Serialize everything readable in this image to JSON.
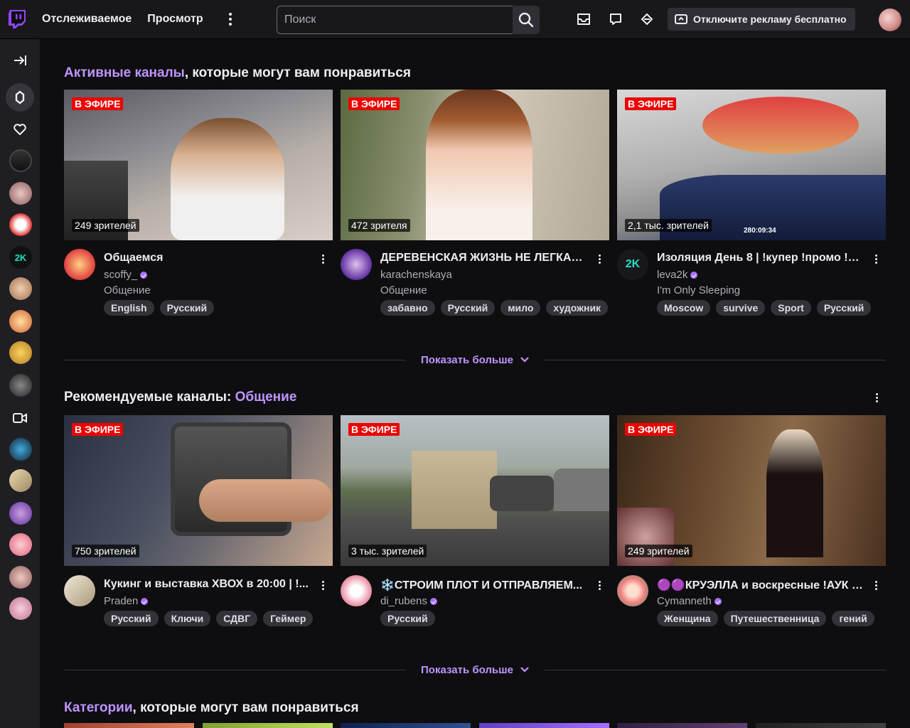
{
  "nav": {
    "following": "Отслеживаемое",
    "browse": "Просмотр",
    "search_placeholder": "Поиск",
    "ad_button": "Отключите рекламу бесплатно"
  },
  "sections": [
    {
      "title_accent": "Активные каналы",
      "title_rest": ", которые могут вам понравиться",
      "show_more": "Показать больше",
      "cards": [
        {
          "live": "В ЭФИРЕ",
          "viewers": "249 зрителей",
          "title": "Общаемся",
          "channel": "scoffy_",
          "category": "Общение",
          "tags": [
            "English",
            "Русский"
          ]
        },
        {
          "live": "В ЭФИРЕ",
          "viewers": "472 зрителя",
          "title": "ДЕРЕВЕНСКАЯ ЖИЗНЬ НЕ ЛЕГКАЯ...",
          "channel": "karachenskaya",
          "category": "Общение",
          "tags": [
            "забавно",
            "Русский",
            "мило",
            "художник"
          ]
        },
        {
          "live": "В ЭФИРЕ",
          "viewers": "2,1 тыс. зрителей",
          "title": "Изоляция День 8 | !купер !промо !и...",
          "channel": "leva2k",
          "category": "I'm Only Sleeping",
          "tags": [
            "Moscow",
            "survive",
            "Sport",
            "Русский"
          ],
          "overlay": "280:09:34"
        }
      ]
    },
    {
      "title_plain": "Рекомендуемые каналы: ",
      "title_accent": "Общение",
      "show_more": "Показать больше",
      "cards": [
        {
          "live": "В ЭФИРЕ",
          "viewers": "750 зрителей",
          "title": "Кукинг и выставка ХВОХ в 20:00 | !...",
          "channel": "Praden",
          "tags": [
            "Русский",
            "Ключи",
            "СДВГ",
            "Геймер"
          ]
        },
        {
          "live": "В ЭФИРЕ",
          "viewers": "3 тыс. зрителей",
          "title": "❄️СТРОИМ ПЛОТ И ОТПРАВЛЯЕМ...",
          "channel": "di_rubens",
          "tags": [
            "Русский"
          ]
        },
        {
          "live": "В ЭФИРЕ",
          "viewers": "249 зрителей",
          "title": "🟣🟣КРУЭЛЛА и воскресные !АУК и...",
          "channel": "Cymanneth",
          "tags": [
            "Женщина",
            "Путешественница",
            "гений"
          ]
        }
      ]
    },
    {
      "title_accent": "Категории",
      "title_rest": ", которые могут вам понравиться"
    }
  ],
  "colors": {
    "accent": "#bf94ff",
    "live": "#eb0400",
    "brand": "#9147ff"
  }
}
